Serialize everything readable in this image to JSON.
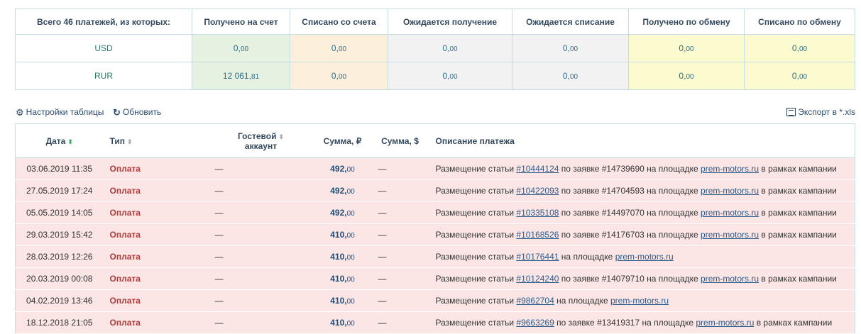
{
  "summary": {
    "header": "Всего 46 платежей, из которых:",
    "columns": [
      "Получено на счет",
      "Списано со счета",
      "Ожидается получение",
      "Ожидается списание",
      "Получено по обмену",
      "Списано по обмену"
    ],
    "rows": [
      {
        "currency": "USD",
        "values": [
          [
            "0,",
            "00"
          ],
          [
            "0,",
            "00"
          ],
          [
            "0,",
            "00"
          ],
          [
            "0,",
            "00"
          ],
          [
            "0,",
            "00"
          ],
          [
            "0,",
            "00"
          ]
        ]
      },
      {
        "currency": "RUR",
        "values": [
          [
            "12 061,",
            "81"
          ],
          [
            "0,",
            "00"
          ],
          [
            "0,",
            "00"
          ],
          [
            "0,",
            "00"
          ],
          [
            "0,",
            "00"
          ],
          [
            "0,",
            "00"
          ]
        ]
      }
    ],
    "column_colors": [
      "#e6f2e1",
      "#fcefdc",
      "#f2f2f2",
      "#f2f2f2",
      "#fbfbcf",
      "#fbfbcf"
    ]
  },
  "toolbar": {
    "settings_label": "Настройки таблицы",
    "refresh_label": "Обновить",
    "export_label": "Экспорт в *.xls",
    "settings_icon": "gear-icon",
    "refresh_icon": "refresh-icon",
    "export_icon": "excel-icon"
  },
  "payments": {
    "headers": {
      "date": "Дата",
      "type": "Тип",
      "guest1": "Гостевой",
      "guest2": "аккаунт",
      "amount_rub": "Сумма, ₽",
      "amount_usd": "Сумма, $",
      "description": "Описание платежа"
    },
    "rows": [
      {
        "date": "03.06.2019 11:35",
        "type": "Оплата",
        "guest": "—",
        "amount_int": "492,",
        "amount_dec": "00",
        "usd": "—",
        "d1": "Размещение статьи ",
        "article": "#10444124",
        "d2": " по заявке #14739690 на площадке ",
        "site": "prem-motors.ru",
        "d3": " в рамках кампании"
      },
      {
        "date": "27.05.2019 17:24",
        "type": "Оплата",
        "guest": "—",
        "amount_int": "492,",
        "amount_dec": "00",
        "usd": "—",
        "d1": "Размещение статьи ",
        "article": "#10422093",
        "d2": " по заявке #14704593 на площадке ",
        "site": "prem-motors.ru",
        "d3": " в рамках кампании"
      },
      {
        "date": "05.05.2019 14:05",
        "type": "Оплата",
        "guest": "—",
        "amount_int": "492,",
        "amount_dec": "00",
        "usd": "—",
        "d1": "Размещение статьи ",
        "article": "#10335108",
        "d2": " по заявке #14497070 на площадке ",
        "site": "prem-motors.ru",
        "d3": " в рамках кампании"
      },
      {
        "date": "29.03.2019 15:42",
        "type": "Оплата",
        "guest": "—",
        "amount_int": "410,",
        "amount_dec": "00",
        "usd": "—",
        "d1": "Размещение статьи ",
        "article": "#10168526",
        "d2": " по заявке #14176703 на площадке ",
        "site": "prem-motors.ru",
        "d3": " в рамках кампании"
      },
      {
        "date": "28.03.2019 12:26",
        "type": "Оплата",
        "guest": "—",
        "amount_int": "410,",
        "amount_dec": "00",
        "usd": "—",
        "d1": "Размещение статьи ",
        "article": "#10176441",
        "d2": " на площадке ",
        "site": "prem-motors.ru",
        "d3": ""
      },
      {
        "date": "20.03.2019 00:08",
        "type": "Оплата",
        "guest": "—",
        "amount_int": "410,",
        "amount_dec": "00",
        "usd": "—",
        "d1": "Размещение статьи ",
        "article": "#10124240",
        "d2": " по заявке #14079710 на площадке ",
        "site": "prem-motors.ru",
        "d3": " в рамках кампании"
      },
      {
        "date": "04.02.2019 13:46",
        "type": "Оплата",
        "guest": "—",
        "amount_int": "410,",
        "amount_dec": "00",
        "usd": "—",
        "d1": "Размещение статьи ",
        "article": "#9862704",
        "d2": " на площадке ",
        "site": "prem-motors.ru",
        "d3": ""
      },
      {
        "date": "18.12.2018 21:05",
        "type": "Оплата",
        "guest": "—",
        "amount_int": "410,",
        "amount_dec": "00",
        "usd": "—",
        "d1": "Размещение статьи ",
        "article": "#9663269",
        "d2": " по заявке #13419317 на площадке ",
        "site": "prem-motors.ru",
        "d3": " в рамках кампании"
      }
    ]
  }
}
